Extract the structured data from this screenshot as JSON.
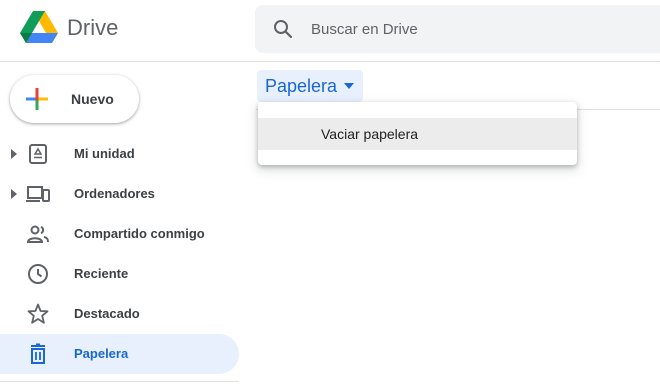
{
  "app": {
    "name": "Drive"
  },
  "search": {
    "placeholder": "Buscar en Drive",
    "icon": "search-icon"
  },
  "new_button": {
    "label": "Nuevo"
  },
  "sidebar": {
    "items": [
      {
        "label": "Mi unidad",
        "icon": "my-drive-icon",
        "expandable": true,
        "active": false
      },
      {
        "label": "Ordenadores",
        "icon": "computers-icon",
        "expandable": true,
        "active": false
      },
      {
        "label": "Compartido conmigo",
        "icon": "shared-icon",
        "expandable": false,
        "active": false
      },
      {
        "label": "Reciente",
        "icon": "clock-icon",
        "expandable": false,
        "active": false
      },
      {
        "label": "Destacado",
        "icon": "star-icon",
        "expandable": false,
        "active": false
      },
      {
        "label": "Papelera",
        "icon": "trash-icon",
        "expandable": false,
        "active": true
      }
    ]
  },
  "breadcrumb": {
    "label": "Papelera"
  },
  "dropdown_menu": {
    "items": [
      {
        "label": "Vaciar papelera"
      }
    ]
  },
  "colors": {
    "accent": "#1967d2",
    "active_bg": "#e8f0fe",
    "search_bg": "#f1f3f4"
  }
}
